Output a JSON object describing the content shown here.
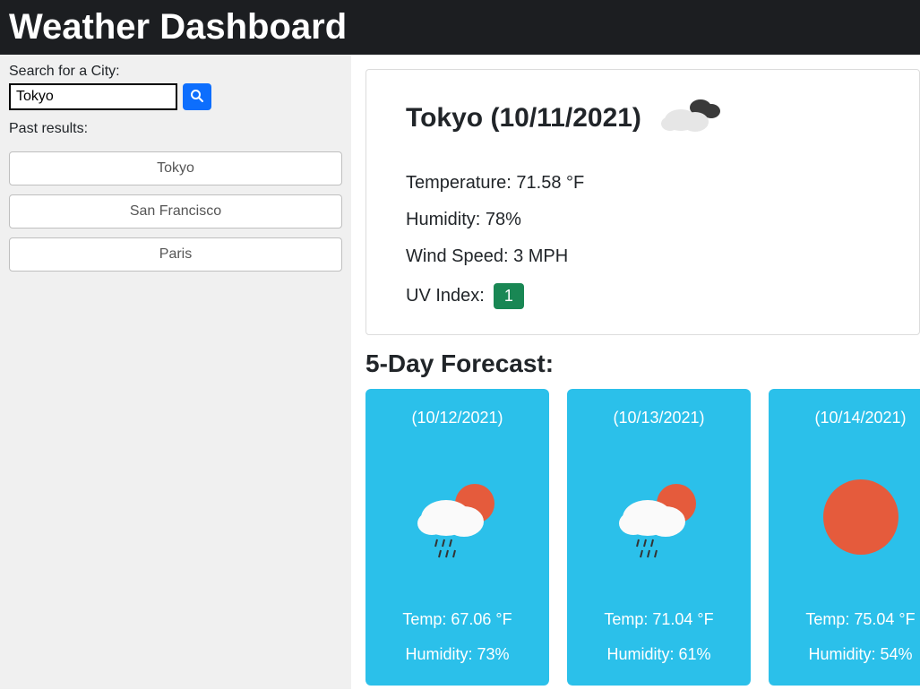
{
  "header": {
    "title": "Weather Dashboard"
  },
  "search": {
    "label": "Search for a City:",
    "value": "Tokyo",
    "placeholder": ""
  },
  "past": {
    "label": "Past results:",
    "items": [
      "Tokyo",
      "San Francisco",
      "Paris"
    ]
  },
  "current": {
    "title": "Tokyo (10/11/2021)",
    "temp_line": "Temperature: 71.58 °F",
    "humidity_line": "Humidity: 78%",
    "wind_line": "Wind Speed: 3 MPH",
    "uv_label": "UV Index:",
    "uv_value": "1",
    "icon": "cloudy"
  },
  "forecast": {
    "title": "5-Day Forecast:",
    "days": [
      {
        "date": "(10/12/2021)",
        "icon": "rain-sun",
        "temp": "Temp: 67.06 °F",
        "humidity": "Humidity: 73%"
      },
      {
        "date": "(10/13/2021)",
        "icon": "rain-sun",
        "temp": "Temp: 71.04 °F",
        "humidity": "Humidity: 61%"
      },
      {
        "date": "(10/14/2021)",
        "icon": "sun",
        "temp": "Temp: 75.04 °F",
        "humidity": "Humidity: 54%"
      }
    ]
  }
}
